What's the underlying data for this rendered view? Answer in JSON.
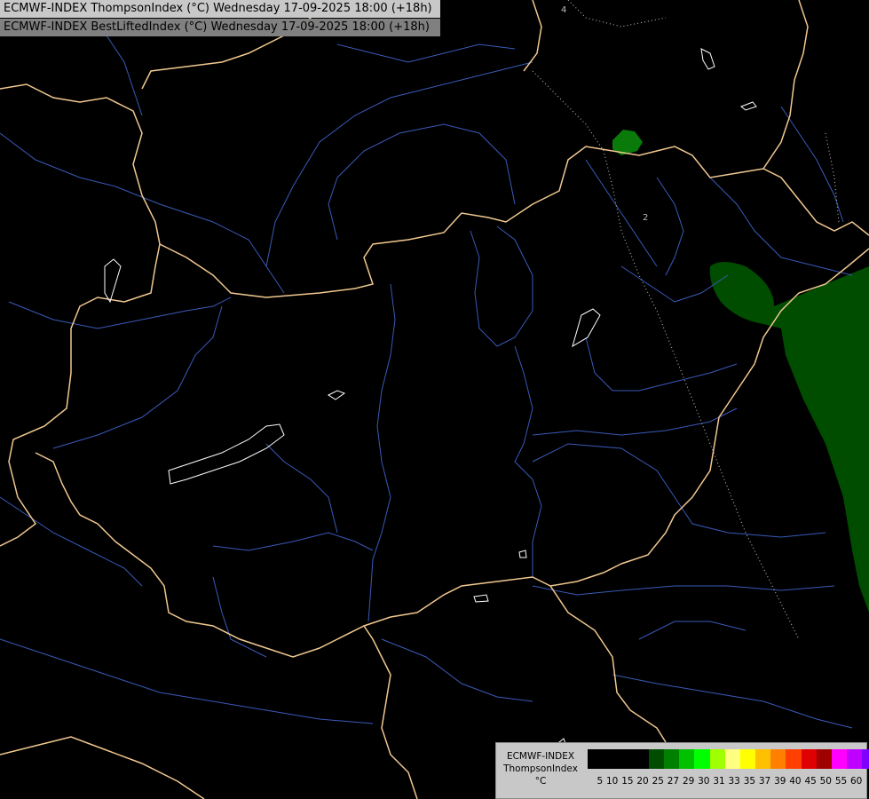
{
  "titles": {
    "line1": "ECMWF-INDEX ThompsonIndex (°C) Wednesday 17-09-2025 18:00 (+18h)",
    "line2": "ECMWF-INDEX BestLiftedIndex (°C) Wednesday 17-09-2025 18:00 (+18h)"
  },
  "legend": {
    "model": "ECMWF-INDEX",
    "parameter": "ThompsonIndex",
    "unit": "°C",
    "ticks": [
      "5",
      "10",
      "15",
      "20",
      "25",
      "27",
      "29",
      "30",
      "31",
      "33",
      "35",
      "37",
      "39",
      "40",
      "45",
      "50",
      "55",
      "60"
    ],
    "colors": [
      "#000000",
      "#000000",
      "#000000",
      "#000000",
      "#004d00",
      "#008000",
      "#00c000",
      "#00ff00",
      "#a0ff00",
      "#ffff80",
      "#ffff00",
      "#ffc000",
      "#ff8000",
      "#ff4000",
      "#e00000",
      "#a00000",
      "#ff00ff",
      "#c000ff",
      "#8000ff",
      "#5000ff",
      "#0000ff"
    ]
  },
  "map_labels": {
    "label_top": "4",
    "label_mid": "2"
  },
  "colors": {
    "border": "#f0c890",
    "river": "#3a5ab8",
    "lake": "#ffffff",
    "field_dark_green": "#004d00",
    "field_green": "#0a7a0a"
  }
}
